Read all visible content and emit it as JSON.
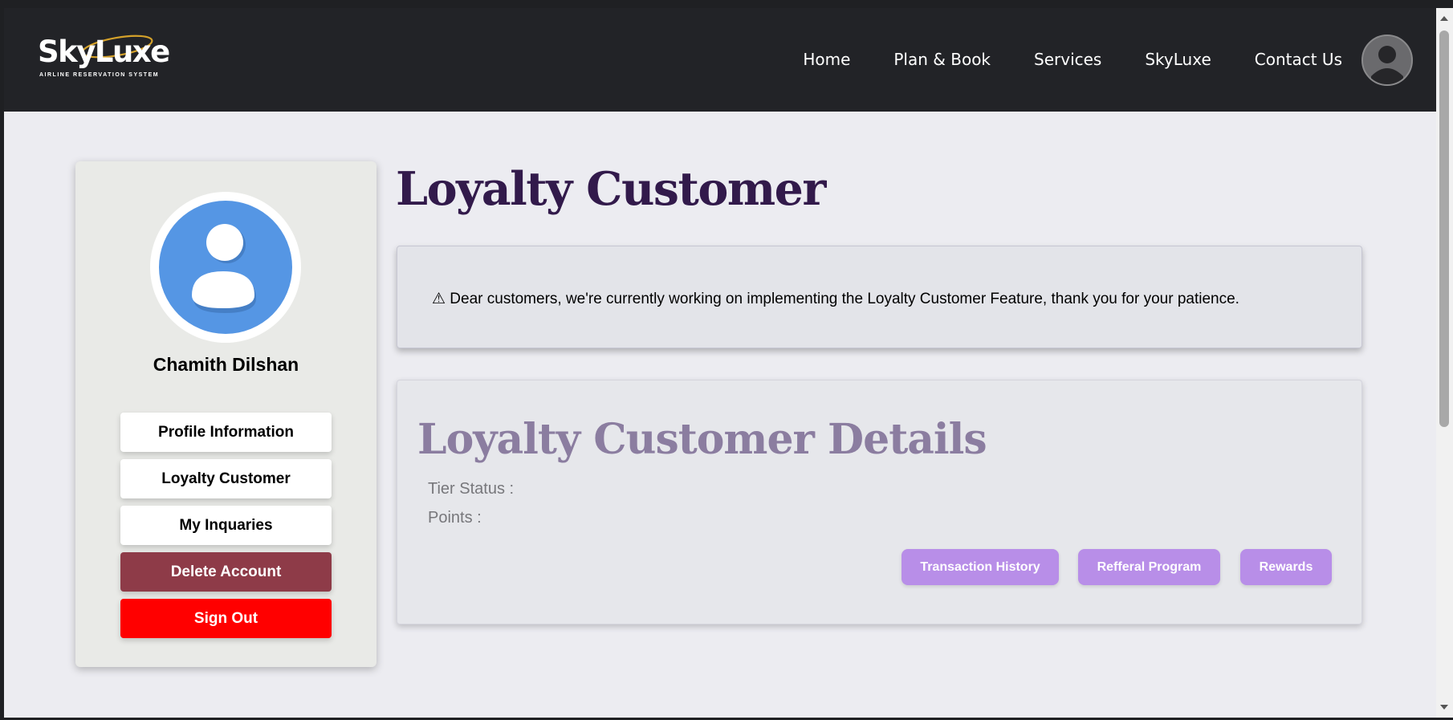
{
  "brand": {
    "name": "SkyLuxe",
    "tagline": "AIRLINE   RESERVATION   SYSTEM"
  },
  "nav": {
    "links": [
      "Home",
      "Plan & Book",
      "Services",
      "SkyLuxe",
      "Contact Us"
    ]
  },
  "sidebar": {
    "user_name": "Chamith Dilshan",
    "buttons": {
      "profile": "Profile Information",
      "loyalty": "Loyalty Customer",
      "inquiries": "My Inquaries",
      "delete": "Delete Account",
      "signout": "Sign Out"
    }
  },
  "main": {
    "title": "Loyalty Customer",
    "notice": "⚠ Dear customers, we're currently working on implementing the Loyalty Customer Feature, thank you for your patience.",
    "details": {
      "title": "Loyalty Customer Details",
      "tier_label": "Tier Status :",
      "points_label": "Points :",
      "buttons": [
        "Transaction History",
        "Refferal Program",
        "Rewards"
      ]
    }
  },
  "colors": {
    "nav_bg": "#222327",
    "title": "#321a4b",
    "details_title": "#8b7da0",
    "pill": "#b88ee8",
    "delete": "#8e3b48",
    "signout": "#ff0000",
    "avatar_blue": "#5596e4"
  },
  "icons": {
    "nav_avatar": "user-avatar-icon",
    "profile_picture": "user-silhouette-icon"
  }
}
